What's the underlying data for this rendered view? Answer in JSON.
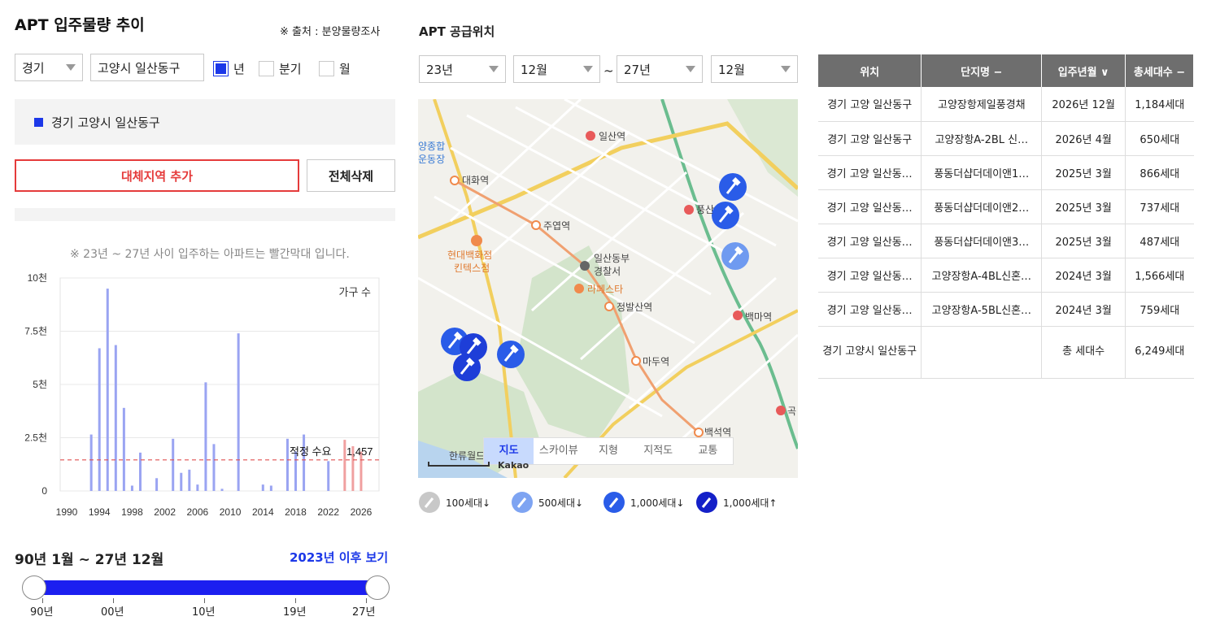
{
  "left": {
    "title": "APT 입주물량 추이",
    "source": "※ 출처 : 분양물량조사",
    "province": "경기",
    "district": "고양시 일산동구",
    "period_options": [
      {
        "label": "년",
        "checked": true
      },
      {
        "label": "분기",
        "checked": false
      },
      {
        "label": "월",
        "checked": false
      }
    ],
    "selected_region": "경기 고양시 일산동구",
    "add_region_button": "대체지역 추가",
    "delete_all_button": "전체삭제",
    "chart_note": "※ 23년 ~ 27년 사이 입주하는 아파트는 빨간막대 입니다.",
    "period_title": "90년 1월 ~ 27년 12월",
    "after_2023_link": "2023년 이후 보기",
    "slider_labels": [
      "90년",
      "00년",
      "10년",
      "19년",
      "27년"
    ]
  },
  "chart_data": {
    "type": "bar",
    "series_name": "가구 수",
    "x": [
      1990,
      1991,
      1992,
      1993,
      1994,
      1995,
      1996,
      1997,
      1998,
      1999,
      2000,
      2001,
      2002,
      2003,
      2004,
      2005,
      2006,
      2007,
      2008,
      2009,
      2010,
      2011,
      2012,
      2013,
      2014,
      2015,
      2016,
      2017,
      2018,
      2019,
      2020,
      2021,
      2022,
      2023,
      2024,
      2025,
      2026,
      2027
    ],
    "values": [
      0,
      0,
      0,
      2650,
      6700,
      9500,
      6850,
      3900,
      250,
      1800,
      0,
      600,
      0,
      2450,
      850,
      1000,
      300,
      5100,
      2200,
      100,
      0,
      7400,
      0,
      0,
      300,
      250,
      0,
      2450,
      1850,
      2650,
      0,
      0,
      1400,
      0,
      2400,
      2100,
      1850,
      0
    ],
    "highlight_years": [
      2023,
      2024,
      2025,
      2026,
      2027
    ],
    "bar_color": "#9aa4f2",
    "highlight_color": "#f0a0a0",
    "ylim": [
      0,
      10000
    ],
    "yticks": [
      0,
      2500,
      5000,
      7500,
      10000
    ],
    "ytick_labels": [
      "0",
      "2.5천",
      "5천",
      "7.5천",
      "10천"
    ],
    "xtick_labels": [
      "1990",
      "1994",
      "1998",
      "2002",
      "2006",
      "2010",
      "2014",
      "2018",
      "2022",
      "2026"
    ],
    "reference_line": {
      "label": "적정 수요",
      "value": 1457,
      "value_label": "1,457",
      "color": "#e05050"
    }
  },
  "middle": {
    "title": "APT 공급위치",
    "from_year": "23년",
    "from_month": "12월",
    "to_year": "27년",
    "to_month": "12월",
    "tilde": "~",
    "map_labels": [
      "일산역",
      "대화역",
      "주엽역",
      "일산동부",
      "경찰서",
      "라페스타",
      "정발산역",
      "현대백화점",
      "킨텍스점",
      "마두역",
      "백석역",
      "백마역",
      "풍산",
      "한류월드",
      "양종합",
      "운동장",
      "곡"
    ],
    "map_tabs": [
      {
        "label": "지도",
        "active": true
      },
      {
        "label": "스카이뷰",
        "active": false
      },
      {
        "label": "지형",
        "active": false
      },
      {
        "label": "지적도",
        "active": false
      },
      {
        "label": "교통",
        "active": false
      }
    ],
    "map_brand": "Kakao",
    "legend": [
      "100세대↓",
      "500세대↓",
      "1,000세대↓",
      "1,000세대↑"
    ]
  },
  "table": {
    "headers": [
      "위치",
      "단지명 −",
      "입주년월 ∨",
      "총세대수 −"
    ],
    "rows": [
      [
        "경기 고양 일산동구",
        "고양장항제일풍경채",
        "2026년 12월",
        "1,184세대"
      ],
      [
        "경기 고양 일산동구",
        "고양장항A-2BL 신…",
        "2026년 4월",
        "650세대"
      ],
      [
        "경기 고양 일산동…",
        "풍동더샵더데이앤1…",
        "2025년 3월",
        "866세대"
      ],
      [
        "경기 고양 일산동…",
        "풍동더샵더데이앤2…",
        "2025년 3월",
        "737세대"
      ],
      [
        "경기 고양 일산동…",
        "풍동더샵더데이앤3…",
        "2025년 3월",
        "487세대"
      ],
      [
        "경기 고양 일산동…",
        "고양장항A-4BL신혼…",
        "2024년 3월",
        "1,566세대"
      ],
      [
        "경기 고양 일산동…",
        "고양장항A-5BL신혼…",
        "2024년 3월",
        "759세대"
      ]
    ],
    "total": {
      "location": "경기 고양시 일산동구",
      "label": "총 세대수",
      "value": "6,249세대"
    }
  },
  "colors": {
    "accent": "#1c38e8",
    "danger": "#e53b3b",
    "header_bg": "#6e6e6e"
  }
}
